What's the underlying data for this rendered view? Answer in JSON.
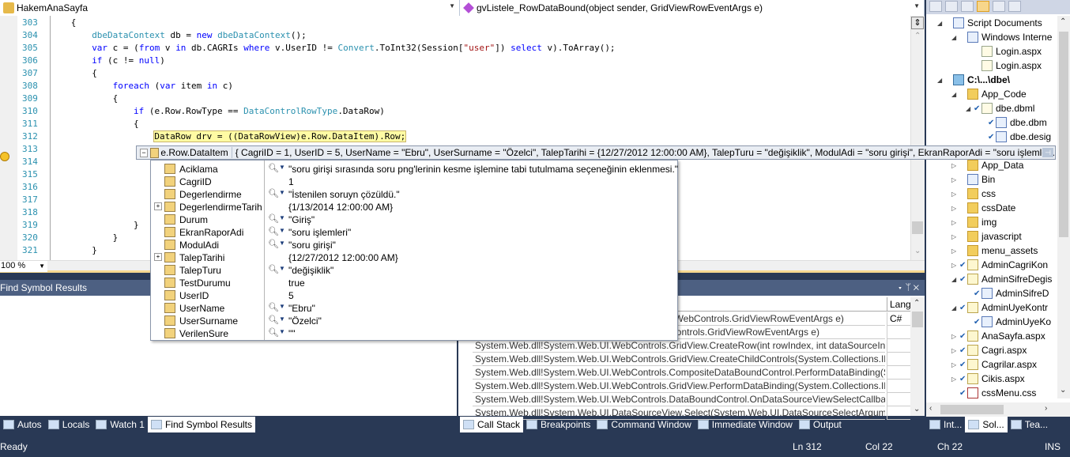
{
  "editor": {
    "class_combo": "HakemAnaSayfa",
    "method_combo": "gvListele_RowDataBound(object sender, GridViewRowEventArgs e)",
    "zoom_level": "100 %",
    "current_line": 312,
    "lines": [
      {
        "num": "303",
        "indent": 3,
        "tokens": [
          {
            "t": "{",
            "c": ""
          }
        ]
      },
      {
        "num": "304",
        "indent": 7,
        "tokens": [
          {
            "t": "dbeDataContext",
            "c": "ty"
          },
          {
            "t": " db = ",
            "c": ""
          },
          {
            "t": "new",
            "c": "kw"
          },
          {
            "t": " ",
            "c": ""
          },
          {
            "t": "dbeDataContext",
            "c": "ty"
          },
          {
            "t": "();",
            "c": ""
          }
        ]
      },
      {
        "num": "305",
        "indent": 7,
        "tokens": [
          {
            "t": "var",
            "c": "kw"
          },
          {
            "t": " c = (",
            "c": ""
          },
          {
            "t": "from",
            "c": "kw"
          },
          {
            "t": " v ",
            "c": ""
          },
          {
            "t": "in",
            "c": "kw"
          },
          {
            "t": " db.CAGRIs ",
            "c": ""
          },
          {
            "t": "where",
            "c": "kw"
          },
          {
            "t": " v.UserID != ",
            "c": ""
          },
          {
            "t": "Convert",
            "c": "ty"
          },
          {
            "t": ".ToInt32(Session[",
            "c": ""
          },
          {
            "t": "\"user\"",
            "c": "st"
          },
          {
            "t": "]) ",
            "c": ""
          },
          {
            "t": "select",
            "c": "kw"
          },
          {
            "t": " v).ToArray();",
            "c": ""
          }
        ]
      },
      {
        "num": "306",
        "indent": 7,
        "tokens": [
          {
            "t": "if",
            "c": "kw"
          },
          {
            "t": " (c != ",
            "c": ""
          },
          {
            "t": "null",
            "c": "kw"
          },
          {
            "t": ")",
            "c": ""
          }
        ]
      },
      {
        "num": "307",
        "indent": 7,
        "tokens": [
          {
            "t": "{",
            "c": ""
          }
        ]
      },
      {
        "num": "308",
        "indent": 11,
        "tokens": [
          {
            "t": "foreach",
            "c": "kw"
          },
          {
            "t": " (",
            "c": ""
          },
          {
            "t": "var",
            "c": "kw"
          },
          {
            "t": " item ",
            "c": ""
          },
          {
            "t": "in",
            "c": "kw"
          },
          {
            "t": " c)",
            "c": ""
          }
        ]
      },
      {
        "num": "309",
        "indent": 11,
        "tokens": [
          {
            "t": "{",
            "c": ""
          }
        ]
      },
      {
        "num": "310",
        "indent": 15,
        "tokens": [
          {
            "t": "if",
            "c": "kw"
          },
          {
            "t": " (e.Row.RowType == ",
            "c": ""
          },
          {
            "t": "DataControlRowType",
            "c": "ty"
          },
          {
            "t": ".DataRow)",
            "c": ""
          }
        ]
      },
      {
        "num": "311",
        "indent": 15,
        "tokens": [
          {
            "t": "{",
            "c": ""
          }
        ]
      },
      {
        "num": "312",
        "indent": 19,
        "tokens": [
          {
            "t": "DataRow drv = ((DataRowView)e.Row.DataItem).Row;",
            "c": "hl"
          }
        ]
      },
      {
        "num": "313",
        "indent": 0,
        "tokens": []
      },
      {
        "num": "314",
        "indent": 0,
        "tokens": []
      },
      {
        "num": "315",
        "indent": 0,
        "tokens": []
      },
      {
        "num": "316",
        "indent": 0,
        "tokens": []
      },
      {
        "num": "317",
        "indent": 0,
        "tokens": []
      },
      {
        "num": "318",
        "indent": 0,
        "tokens": []
      },
      {
        "num": "319",
        "indent": 15,
        "tokens": [
          {
            "t": "}",
            "c": ""
          }
        ]
      },
      {
        "num": "320",
        "indent": 11,
        "tokens": [
          {
            "t": "}",
            "c": ""
          }
        ]
      },
      {
        "num": "321",
        "indent": 7,
        "tokens": [
          {
            "t": "}",
            "c": ""
          }
        ]
      }
    ]
  },
  "datatip": {
    "expression": "e.Row.DataItem",
    "summary": "{ CagriID = 1, UserID = 5, UserName = \"Ebru\", UserSurname = \"Özelci\", TalepTarihi = {12/27/2012 12:00:00 AM}, TalepTuru = \"değişiklik\", ModulAdi = \"soru girişi\", EkranRaporAdi = \"soru işlemle...",
    "members": [
      {
        "name": "Aciklama",
        "value": "\"soru girişi sırasında soru png'lerinin kesme işlemine tabi tutulmama seçeneğinin eklenmesi.\"",
        "visualizer": true,
        "expandable": false
      },
      {
        "name": "CagriID",
        "value": "1",
        "visualizer": false,
        "expandable": false
      },
      {
        "name": "Degerlendirme",
        "value": "\"İstenilen soruyn çözüldü.\"",
        "visualizer": true,
        "expandable": false
      },
      {
        "name": "DegerlendirmeTarih",
        "value": "{1/13/2014 12:00:00 AM}",
        "visualizer": false,
        "expandable": true
      },
      {
        "name": "Durum",
        "value": "\"Giriş\"",
        "visualizer": true,
        "expandable": false
      },
      {
        "name": "EkranRaporAdi",
        "value": "\"soru işlemleri\"",
        "visualizer": true,
        "expandable": false
      },
      {
        "name": "ModulAdi",
        "value": "\"soru girişi\"",
        "visualizer": true,
        "expandable": false
      },
      {
        "name": "TalepTarihi",
        "value": "{12/27/2012 12:00:00 AM}",
        "visualizer": false,
        "expandable": true
      },
      {
        "name": "TalepTuru",
        "value": "\"değişiklik\"",
        "visualizer": true,
        "expandable": false
      },
      {
        "name": "TestDurumu",
        "value": "true",
        "visualizer": false,
        "expandable": false
      },
      {
        "name": "UserID",
        "value": "5",
        "visualizer": false,
        "expandable": false
      },
      {
        "name": "UserName",
        "value": "\"Ebru\"",
        "visualizer": true,
        "expandable": false
      },
      {
        "name": "UserSurname",
        "value": "\"Özelci\"",
        "visualizer": true,
        "expandable": false
      },
      {
        "name": "VerilenSure",
        "value": "\"\"",
        "visualizer": true,
        "expandable": false
      }
    ]
  },
  "find_symbol_panel": {
    "title": "Find Symbol Results"
  },
  "call_stack_panel": {
    "lang_header": "Lang",
    "rows": [
      {
        "name": "RowDataBound(object sender, System.Web.UI.WebControls.GridViewRowEventArgs e)",
        "lang": "C#"
      },
      {
        "name": "lView.OnRowDataBound(System.Web.UI.WebControls.GridViewRowEventArgs e)",
        "lang": ""
      },
      {
        "name": "System.Web.dll!System.Web.UI.WebControls.GridView.CreateRow(int rowIndex, int dataSourceIndex",
        "lang": ""
      },
      {
        "name": "System.Web.dll!System.Web.UI.WebControls.GridView.CreateChildControls(System.Collections.IEnumerable",
        "lang": ""
      },
      {
        "name": "System.Web.dll!System.Web.UI.WebControls.CompositeDataBoundControl.PerformDataBinding(System",
        "lang": ""
      },
      {
        "name": "System.Web.dll!System.Web.UI.WebControls.GridView.PerformDataBinding(System.Collections.IEnumerable",
        "lang": ""
      },
      {
        "name": "System.Web.dll!System.Web.UI.WebControls.DataBoundControl.OnDataSourceViewSelectCallback",
        "lang": ""
      },
      {
        "name": "System.Web.dll!System.Web.UI.DataSourceView.Select(System.Web.UI.DataSourceSelectArguments",
        "lang": ""
      }
    ]
  },
  "left_tabs": [
    "Autos",
    "Locals",
    "Watch 1",
    "Find Symbol Results"
  ],
  "left_active_tab": 3,
  "right_tabs": [
    "Call Stack",
    "Breakpoints",
    "Command Window",
    "Immediate Window",
    "Output"
  ],
  "right_active_tab": 0,
  "se_tabs": [
    "Int...",
    "Sol...",
    "Tea..."
  ],
  "se_active_tab": 1,
  "solution_explorer": {
    "items": [
      {
        "label": "Script Documents",
        "level": 0,
        "expander": "open",
        "check": false,
        "icon": "ic-cs"
      },
      {
        "label": "Windows Interne",
        "level": 1,
        "expander": "open",
        "check": false,
        "icon": "ic-cs"
      },
      {
        "label": "Login.aspx",
        "level": 2,
        "expander": "",
        "check": false,
        "icon": "ic-page"
      },
      {
        "label": "Login.aspx",
        "level": 2,
        "expander": "",
        "check": false,
        "icon": "ic-page"
      },
      {
        "label": "C:\\...\\dbe\\",
        "level": 0,
        "expander": "open",
        "check": false,
        "icon": "ic-web",
        "bold": true
      },
      {
        "label": "App_Code",
        "level": 1,
        "expander": "open",
        "check": false,
        "icon": "ic-folder"
      },
      {
        "label": "dbe.dbml",
        "level": 2,
        "expander": "open",
        "check": true,
        "icon": "ic-page"
      },
      {
        "label": "dbe.dbm",
        "level": 3,
        "expander": "",
        "check": true,
        "icon": "ic-cs"
      },
      {
        "label": "dbe.desig",
        "level": 3,
        "expander": "",
        "check": true,
        "icon": "ic-cs"
      },
      {
        "label": "",
        "level": 3,
        "expander": "",
        "check": false,
        "icon": "ic-page"
      },
      {
        "label": "App_Data",
        "level": 1,
        "expander": "closed",
        "check": false,
        "icon": "ic-folder"
      },
      {
        "label": "Bin",
        "level": 1,
        "expander": "closed",
        "check": false,
        "icon": "ic-cs"
      },
      {
        "label": "css",
        "level": 1,
        "expander": "closed",
        "check": false,
        "icon": "ic-folder"
      },
      {
        "label": "cssDate",
        "level": 1,
        "expander": "closed",
        "check": false,
        "icon": "ic-folder"
      },
      {
        "label": "img",
        "level": 1,
        "expander": "closed",
        "check": false,
        "icon": "ic-folder"
      },
      {
        "label": "javascript",
        "level": 1,
        "expander": "closed",
        "check": false,
        "icon": "ic-folder"
      },
      {
        "label": "menu_assets",
        "level": 1,
        "expander": "closed",
        "check": false,
        "icon": "ic-folder"
      },
      {
        "label": "AdminCagriKon",
        "level": 1,
        "expander": "closed",
        "check": true,
        "icon": "ic-file"
      },
      {
        "label": "AdminSifreDegis",
        "level": 1,
        "expander": "open",
        "check": true,
        "icon": "ic-file"
      },
      {
        "label": "AdminSifreD",
        "level": 2,
        "expander": "",
        "check": true,
        "icon": "ic-cs"
      },
      {
        "label": "AdminUyeKontr",
        "level": 1,
        "expander": "open",
        "check": true,
        "icon": "ic-file"
      },
      {
        "label": "AdminUyeKo",
        "level": 2,
        "expander": "",
        "check": true,
        "icon": "ic-cs"
      },
      {
        "label": "AnaSayfa.aspx",
        "level": 1,
        "expander": "closed",
        "check": true,
        "icon": "ic-file"
      },
      {
        "label": "Cagri.aspx",
        "level": 1,
        "expander": "closed",
        "check": true,
        "icon": "ic-file"
      },
      {
        "label": "Cagrilar.aspx",
        "level": 1,
        "expander": "closed",
        "check": true,
        "icon": "ic-file"
      },
      {
        "label": "Cikis.aspx",
        "level": 1,
        "expander": "closed",
        "check": true,
        "icon": "ic-file"
      },
      {
        "label": "cssMenu.css",
        "level": 1,
        "expander": "",
        "check": true,
        "icon": "ic-css"
      }
    ]
  },
  "statusbar": {
    "message": "Ready",
    "line": "Ln 312",
    "col": "Col 22",
    "ch": "Ch 22",
    "mode": "INS"
  }
}
